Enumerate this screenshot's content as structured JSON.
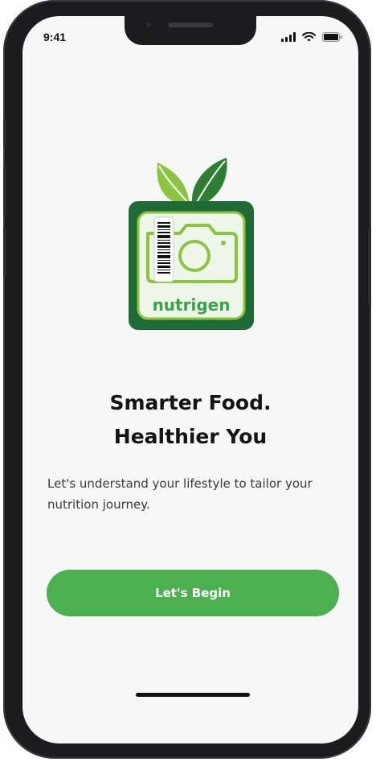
{
  "status_bar": {
    "time": "9:41",
    "icons": [
      "signal-icon",
      "wifi-icon",
      "battery-icon"
    ]
  },
  "logo": {
    "text": "nutrigen",
    "colors": {
      "dark_green": "#1e6b35",
      "light_green": "#8cc43f",
      "leaf_light": "#8cc43f",
      "leaf_dark": "#2e7d32",
      "tile_inner": "#eef6ea"
    }
  },
  "headline": {
    "line1": "Smarter Food.",
    "line2": "Healthier You"
  },
  "subtitle": "Let's understand your lifestyle to tailor your nutrition journey.",
  "cta": {
    "label": "Let's Begin",
    "color": "#4caf50"
  }
}
